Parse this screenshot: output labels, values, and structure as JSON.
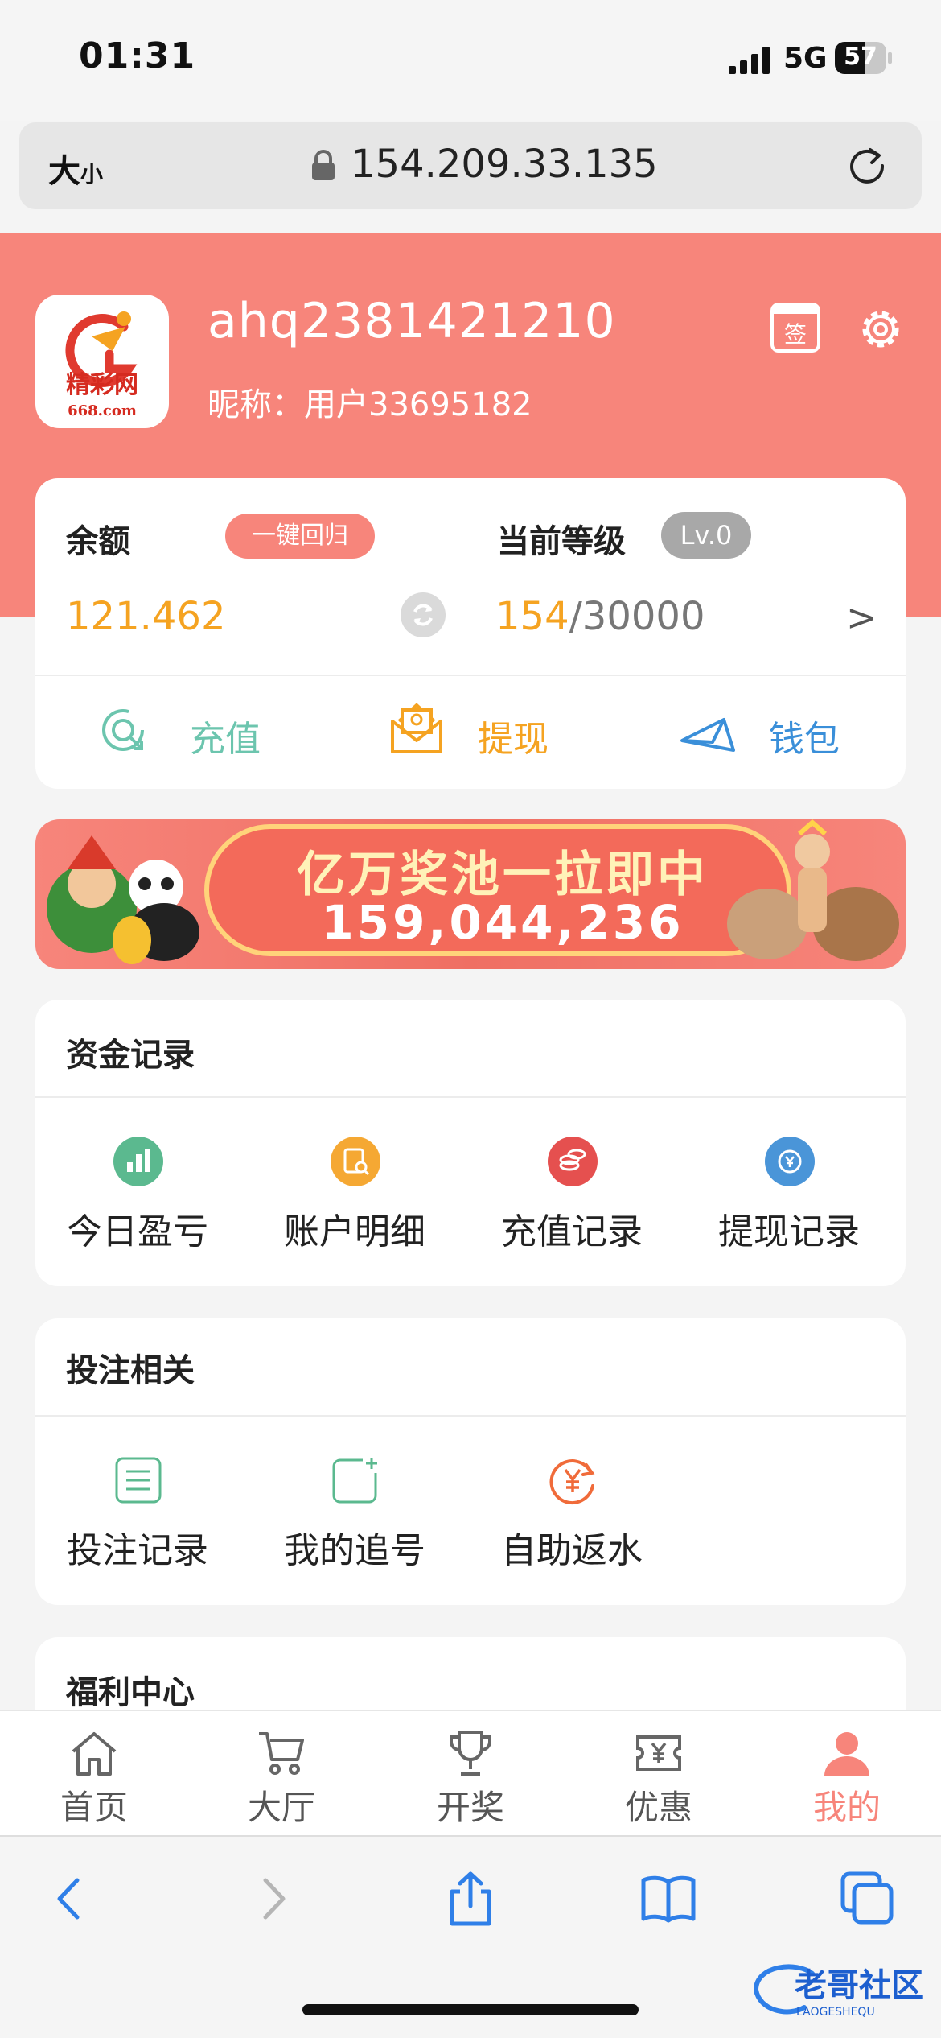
{
  "status_bar": {
    "time": "01:31",
    "network": "5G",
    "battery": "57"
  },
  "browser": {
    "text_size": "大",
    "text_size_small": "小",
    "url": "154.209.33.135"
  },
  "profile": {
    "username": "ahq2381421210",
    "nickname": "昵称：用户33695182",
    "signin_label": "签",
    "logo_text": "精彩网",
    "logo_domain": "668.com"
  },
  "account": {
    "balance_label": "余额",
    "recall_button": "一键回归",
    "balance_value": "121.462",
    "level_label": "当前等级",
    "level_badge": "Lv.0",
    "level_current": "154",
    "level_total": "/30000",
    "arrow": ">",
    "actions": [
      {
        "label": "充值"
      },
      {
        "label": "提现"
      },
      {
        "label": "钱包"
      }
    ]
  },
  "banner": {
    "title": "亿万奖池一拉即中",
    "amount": "159,044,236"
  },
  "funds": {
    "title": "资金记录",
    "items": [
      {
        "label": "今日盈亏",
        "color": "#5bb98f"
      },
      {
        "label": "账户明细",
        "color": "#f5a833"
      },
      {
        "label": "充值记录",
        "color": "#e5504f"
      },
      {
        "label": "提现记录",
        "color": "#4a95d8"
      }
    ]
  },
  "bets": {
    "title": "投注相关",
    "items": [
      {
        "label": "投注记录"
      },
      {
        "label": "我的追号"
      },
      {
        "label": "自助返水"
      }
    ]
  },
  "welfare": {
    "title": "福利中心"
  },
  "tabs": [
    {
      "label": "首页"
    },
    {
      "label": "大厅"
    },
    {
      "label": "开奖"
    },
    {
      "label": "优惠"
    },
    {
      "label": "我的"
    }
  ],
  "colors": {
    "accent": "#f7857b",
    "gold": "#f5a321",
    "teal": "#6cc5ae",
    "blue": "#3a8fd9"
  },
  "watermark": {
    "text": "老哥社区",
    "sub": "LAOGESHEQU"
  }
}
